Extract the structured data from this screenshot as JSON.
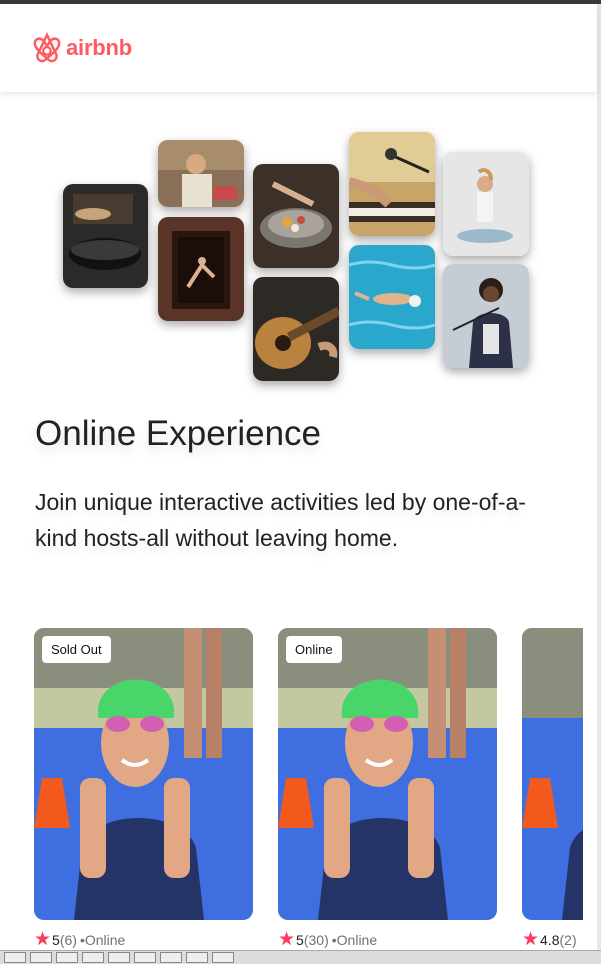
{
  "brand": {
    "name": "airbnb",
    "color": "#FF5A5F"
  },
  "hero": {
    "title": "Online Experience",
    "subtitle": "Join unique interactive activities led by one-of-a-kind hosts-all without leaving home."
  },
  "collage": [
    "cooking-pot-photo",
    "chef-woman-photo",
    "dancer-doorway-photo",
    "food-bowl-photo",
    "guitar-photo",
    "piano-microphone-photo",
    "swimmer-pool-photo",
    "yoga-woman-photo",
    "singer-performer-photo"
  ],
  "cards": [
    {
      "badge": "Sold Out",
      "rating": "5",
      "count": "(6)",
      "location": "•Online"
    },
    {
      "badge": "Online",
      "rating": "5",
      "count": "(30)",
      "location": "•Online"
    },
    {
      "badge": "",
      "rating": "4.8",
      "count": "(2)",
      "location": ""
    }
  ],
  "icons": {
    "star": "★"
  },
  "colors": {
    "accent": "#FF385C",
    "muted": "#717171"
  }
}
